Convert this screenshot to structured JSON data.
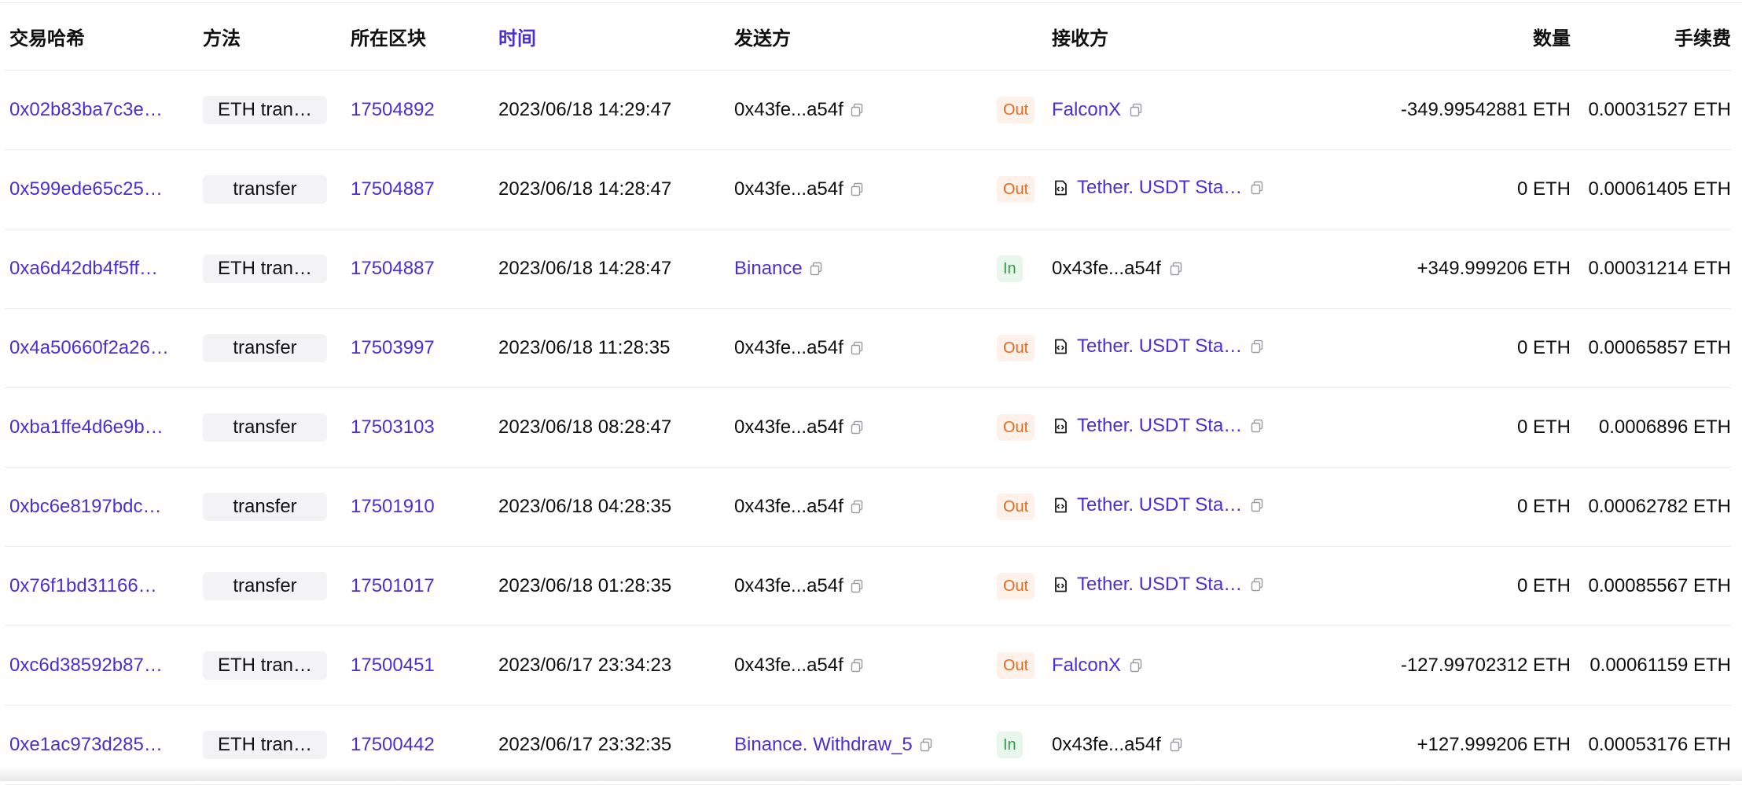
{
  "header": {
    "hash": "交易哈希",
    "method": "方法",
    "block": "所在区块",
    "time": "时间",
    "from": "发送方",
    "to": "接收方",
    "amount": "数量",
    "fee": "手续费"
  },
  "colors": {
    "link": "#4a2fd3",
    "out": "#e56a1e",
    "in": "#2f9e44"
  },
  "rows": [
    {
      "hash": "0x02b83ba7c3e…",
      "method": "ETH tran…",
      "block": "17504892",
      "time": "2023/06/18 14:29:47",
      "from": "0x43fe...a54f",
      "from_link": false,
      "dir": "Out",
      "to": "FalconX",
      "to_link": true,
      "to_contract": false,
      "amount": "-349.99542881 ETH",
      "fee": "0.00031527 ETH"
    },
    {
      "hash": "0x599ede65c25…",
      "method": "transfer",
      "block": "17504887",
      "time": "2023/06/18 14:28:47",
      "from": "0x43fe...a54f",
      "from_link": false,
      "dir": "Out",
      "to": "Tether. USDT Sta…",
      "to_link": true,
      "to_contract": true,
      "amount": "0 ETH",
      "fee": "0.00061405 ETH"
    },
    {
      "hash": "0xa6d42db4f5ff…",
      "method": "ETH tran…",
      "block": "17504887",
      "time": "2023/06/18 14:28:47",
      "from": "Binance",
      "from_link": true,
      "dir": "In",
      "to": "0x43fe...a54f",
      "to_link": false,
      "to_contract": false,
      "amount": "+349.999206 ETH",
      "fee": "0.00031214 ETH"
    },
    {
      "hash": "0x4a50660f2a26…",
      "method": "transfer",
      "block": "17503997",
      "time": "2023/06/18 11:28:35",
      "from": "0x43fe...a54f",
      "from_link": false,
      "dir": "Out",
      "to": "Tether. USDT Sta…",
      "to_link": true,
      "to_contract": true,
      "amount": "0 ETH",
      "fee": "0.00065857 ETH"
    },
    {
      "hash": "0xba1ffe4d6e9b…",
      "method": "transfer",
      "block": "17503103",
      "time": "2023/06/18 08:28:47",
      "from": "0x43fe...a54f",
      "from_link": false,
      "dir": "Out",
      "to": "Tether. USDT Sta…",
      "to_link": true,
      "to_contract": true,
      "amount": "0 ETH",
      "fee": "0.0006896 ETH"
    },
    {
      "hash": "0xbc6e8197bdc…",
      "method": "transfer",
      "block": "17501910",
      "time": "2023/06/18 04:28:35",
      "from": "0x43fe...a54f",
      "from_link": false,
      "dir": "Out",
      "to": "Tether. USDT Sta…",
      "to_link": true,
      "to_contract": true,
      "amount": "0 ETH",
      "fee": "0.00062782 ETH"
    },
    {
      "hash": "0x76f1bd31166…",
      "method": "transfer",
      "block": "17501017",
      "time": "2023/06/18 01:28:35",
      "from": "0x43fe...a54f",
      "from_link": false,
      "dir": "Out",
      "to": "Tether. USDT Sta…",
      "to_link": true,
      "to_contract": true,
      "amount": "0 ETH",
      "fee": "0.00085567 ETH"
    },
    {
      "hash": "0xc6d38592b87…",
      "method": "ETH tran…",
      "block": "17500451",
      "time": "2023/06/17 23:34:23",
      "from": "0x43fe...a54f",
      "from_link": false,
      "dir": "Out",
      "to": "FalconX",
      "to_link": true,
      "to_contract": false,
      "amount": "-127.99702312 ETH",
      "fee": "0.00061159 ETH"
    },
    {
      "hash": "0xe1ac973d285…",
      "method": "ETH tran…",
      "block": "17500442",
      "time": "2023/06/17 23:32:35",
      "from": "Binance. Withdraw_5",
      "from_link": true,
      "dir": "In",
      "to": "0x43fe...a54f",
      "to_link": false,
      "to_contract": false,
      "amount": "+127.999206 ETH",
      "fee": "0.00053176 ETH"
    }
  ]
}
